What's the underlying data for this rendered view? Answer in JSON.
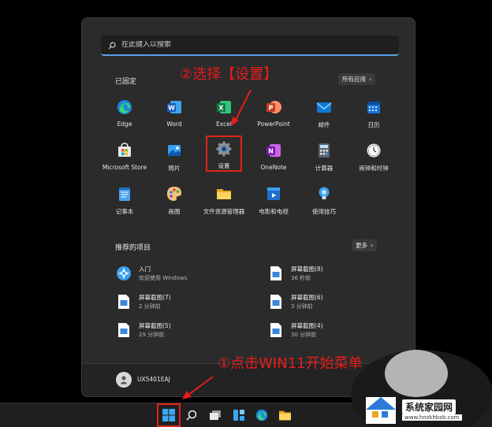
{
  "search": {
    "placeholder": "在此键入以搜索"
  },
  "pinned": {
    "title": "已固定",
    "all_apps_label": "所有应用",
    "apps": [
      {
        "label": "Edge",
        "icon": "edge-icon"
      },
      {
        "label": "Word",
        "icon": "word-icon"
      },
      {
        "label": "Excel",
        "icon": "excel-icon"
      },
      {
        "label": "PowerPoint",
        "icon": "powerpoint-icon"
      },
      {
        "label": "邮件",
        "icon": "mail-icon"
      },
      {
        "label": "日历",
        "icon": "calendar-icon"
      },
      {
        "label": "Microsoft Store",
        "icon": "store-icon"
      },
      {
        "label": "照片",
        "icon": "photos-icon"
      },
      {
        "label": "设置",
        "icon": "settings-icon"
      },
      {
        "label": "OneNote",
        "icon": "onenote-icon"
      },
      {
        "label": "计算器",
        "icon": "calculator-icon"
      },
      {
        "label": "闹钟和时钟",
        "icon": "clock-icon"
      },
      {
        "label": "记事本",
        "icon": "notepad-icon"
      },
      {
        "label": "画图",
        "icon": "paint-icon"
      },
      {
        "label": "文件资源管理器",
        "icon": "folder-icon"
      },
      {
        "label": "电影和电视",
        "icon": "movies-icon"
      },
      {
        "label": "使用技巧",
        "icon": "tips-icon"
      }
    ]
  },
  "recommended": {
    "title": "推荐的项目",
    "more_label": "更多",
    "items": [
      {
        "title": "入门",
        "subtitle": "欢迎使用 Windows"
      },
      {
        "title": "屏幕截图(8)",
        "subtitle": "36 秒前"
      },
      {
        "title": "屏幕截图(7)",
        "subtitle": "2 分钟前"
      },
      {
        "title": "屏幕截图(6)",
        "subtitle": "3 分钟前"
      },
      {
        "title": "屏幕截图(5)",
        "subtitle": "29 分钟前"
      },
      {
        "title": "屏幕截图(4)",
        "subtitle": "30 分钟前"
      }
    ]
  },
  "user": {
    "name": "UX5401EAJ"
  },
  "annotations": {
    "step2": "②选择【设置】",
    "step1": "①点击WIN11开始菜单"
  },
  "watermark": {
    "name": "系统家园网",
    "url": "www.hnzkhbsb.com"
  },
  "colors": {
    "annotation": "#e81c1c",
    "accent": "#5aa0e6",
    "menu_bg": "#2b2b2b"
  }
}
